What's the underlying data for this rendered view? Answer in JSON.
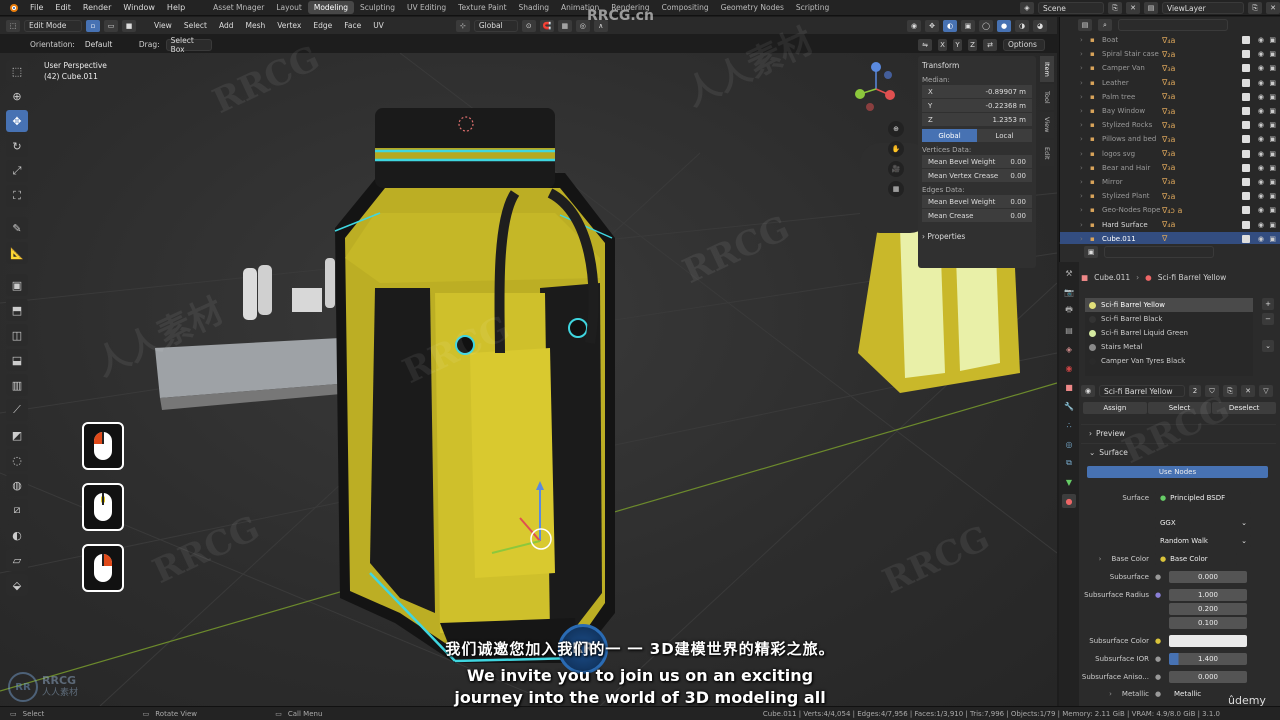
{
  "topbar": {
    "menus": [
      "File",
      "Edit",
      "Render",
      "Window",
      "Help"
    ],
    "workspaces": [
      "Asset Mnager",
      "Layout",
      "Modeling",
      "Sculpting",
      "UV Editing",
      "Texture Paint",
      "Shading",
      "Animation",
      "Rendering",
      "Compositing",
      "Geometry Nodes",
      "Scripting"
    ],
    "active_workspace": "Modeling",
    "scene": "Scene",
    "view_layer": "ViewLayer"
  },
  "viewport_header": {
    "mode": "Edit Mode",
    "menus": [
      "View",
      "Select",
      "Add",
      "Mesh",
      "Vertex",
      "Edge",
      "Face",
      "UV"
    ],
    "transform_orientation": "Global",
    "orientation_label": "Orientation:",
    "orientation_value": "Default",
    "drag_label": "Drag:",
    "drag_value": "Select Box",
    "axes": [
      "X",
      "Y",
      "Z"
    ],
    "options": "Options"
  },
  "viewport": {
    "perspective": "User Perspective",
    "object": "(42) Cube.011"
  },
  "npanel": {
    "section": "Transform",
    "median_label": "Median:",
    "x_label": "X",
    "x_value": "-0.89907 m",
    "y_label": "Y",
    "y_value": "-0.22368 m",
    "z_label": "Z",
    "z_value": "1.2353 m",
    "global": "Global",
    "local": "Local",
    "vertices_data": "Vertices Data:",
    "mean_bevel_weight_label": "Mean Bevel Weight",
    "mean_bevel_weight_v": "0.00",
    "mean_vertex_crease_label": "Mean Vertex Crease",
    "mean_vertex_crease": "0.00",
    "edges_data": "Edges Data:",
    "mean_bevel_weight_e_label": "Mean Bevel Weight",
    "mean_bevel_weight_e": "0.00",
    "mean_crease_label": "Mean Crease",
    "mean_crease": "0.00",
    "properties": "Properties",
    "tabs": [
      "Item",
      "Tool",
      "View",
      "Edit"
    ]
  },
  "outliner": {
    "items": [
      {
        "name": "Boat",
        "deco": "∇₄a"
      },
      {
        "name": "Spiral Stair case",
        "deco": "∇₂a"
      },
      {
        "name": "Camper Van",
        "deco": "∇₃a"
      },
      {
        "name": "Leather",
        "deco": "∇₄a"
      },
      {
        "name": "Palm tree",
        "deco": "∇₃a"
      },
      {
        "name": "Bay Window",
        "deco": "∇₃a"
      },
      {
        "name": "Stylized Rocks",
        "deco": "∇₃a"
      },
      {
        "name": "Pillows and bed",
        "deco": "∇₃a"
      },
      {
        "name": "logos svg",
        "deco": "∇₃a"
      },
      {
        "name": "Bear and Hair",
        "deco": "∇₃a"
      },
      {
        "name": "Mirror",
        "deco": "∇₃a"
      },
      {
        "name": "Stylized Plant",
        "deco": "∇₂a"
      },
      {
        "name": "Geo-Nodes Rope",
        "deco": "∇₄ɔ a"
      },
      {
        "name": "Hard Surface",
        "deco": "∇₄a"
      },
      {
        "name": "Cube.011",
        "deco": "∇"
      }
    ]
  },
  "properties": {
    "object": "Cube.011",
    "material": "Sci-fi Barrel Yellow",
    "slots": [
      {
        "name": "Sci-fi Barrel Yellow",
        "color": "#e2e07a"
      },
      {
        "name": "Sci-fi Barrel Black",
        "color": "#333333"
      },
      {
        "name": "Sci-fi Barrel Liquid Green",
        "color": "#d4e9a0"
      },
      {
        "name": "Stairs Metal",
        "color": "#8a8a8a"
      },
      {
        "name": "Camper Van Tyres Black",
        "color": "#2a2a2a"
      }
    ],
    "material_users": "2",
    "assign": "Assign",
    "select": "Select",
    "deselect": "Deselect",
    "preview": "Preview",
    "surface_section": "Surface",
    "use_nodes": "Use Nodes",
    "surface_label": "Surface",
    "surface_value": "Principled BSDF",
    "distribution": "GGX",
    "subsurface_method": "Random Walk",
    "base_color_label": "Base Color",
    "base_color_value": "Base Color",
    "subsurface_label": "Subsurface",
    "subsurface_value": "0.000",
    "subsurface_radius_label": "Subsurface Radius",
    "subsurface_radius": [
      "1.000",
      "0.200",
      "0.100"
    ],
    "subsurface_color_label": "Subsurface Color",
    "subsurface_ior_label": "Subsurface IOR",
    "subsurface_ior": "1.400",
    "subsurface_aniso_label": "Subsurface Aniso...",
    "subsurface_aniso": "0.000",
    "metallic_label": "Metallic",
    "metallic_value": "Metallic"
  },
  "statusbar": {
    "select": "Select",
    "rotate": "Rotate View",
    "call_menu": "Call Menu",
    "stats": "Cube.011 | Verts:4/4,054 | Edges:4/7,956 | Faces:1/3,910 | Tris:7,996 | Objects:1/79 | Memory: 2.11 GiB | VRAM: 4.9/8.0 GiB | 3.1.0"
  },
  "subtitles": {
    "chinese": "我们诚邀您加入我们的一   一     3D建模世界的精彩之旅。",
    "english_line1": "We invite you to join us on an exciting",
    "english_line2": "journey into the world of 3D modeling all"
  },
  "watermark": {
    "text1": "RRCG.cn",
    "brand": "RRCG",
    "brand_cn": "人人素材",
    "udemy": "ûdemy"
  },
  "colors": {
    "accent": "#4772b3",
    "barrel_yellow": "#c8b62a",
    "edge_cyan": "#3fd6e0"
  }
}
